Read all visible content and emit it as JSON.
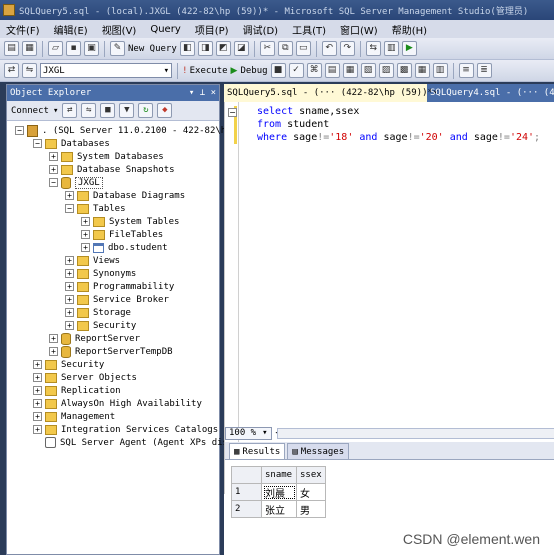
{
  "window": {
    "title": "SQLQuery5.sql - (local).JXGL (422-82\\hp (59))* - Microsoft SQL Server Management Studio(管理员)"
  },
  "menu": {
    "items": [
      "文件(F)",
      "编辑(E)",
      "视图(V)",
      "Query",
      "项目(P)",
      "调试(D)",
      "工具(T)",
      "窗口(W)",
      "帮助(H)"
    ]
  },
  "toolbar": {
    "new_query_label": "New Query",
    "database": "JXGL",
    "execute_label": "Execute",
    "debug_label": "Debug"
  },
  "object_explorer": {
    "title": "Object Explorer",
    "connect_label": "Connect",
    "server": ". (SQL Server 11.0.2100 - 422-82\\hp",
    "nodes": {
      "databases": "Databases",
      "system_databases": "System Databases",
      "database_snapshots": "Database Snapshots",
      "jxgl": "JXGL",
      "database_diagrams": "Database Diagrams",
      "tables": "Tables",
      "system_tables": "System Tables",
      "file_tables": "FileTables",
      "dbo_student": "dbo.student",
      "views": "Views",
      "synonyms": "Synonyms",
      "programmability": "Programmability",
      "service_broker": "Service Broker",
      "storage": "Storage",
      "security_db": "Security",
      "report_server": "ReportServer",
      "report_server_temp": "ReportServerTempDB",
      "security": "Security",
      "server_objects": "Server Objects",
      "replication": "Replication",
      "alwayson": "AlwaysOn High Availability",
      "management": "Management",
      "integration": "Integration Services Catalogs",
      "agent": "SQL Server Agent (Agent XPs dis"
    }
  },
  "tabs": {
    "active": "SQLQuery5.sql - (··· (422-82\\hp (59))*",
    "inactive": "SQLQuery4.sql - (··· (422-8"
  },
  "editor": {
    "line1": {
      "kw": "select",
      "rest": " sname,ssex"
    },
    "line2": {
      "kw": "from",
      "rest": " student"
    },
    "line3": {
      "kw1": "where",
      "col1": " sage",
      "op1": "!=",
      "val1": "'18'",
      "kw2": " and",
      "col2": " sage",
      "op2": "!=",
      "val2": "'20'",
      "kw3": "  and",
      "col3": " sage",
      "op3": "!=",
      "val3": "'24'",
      "end": ";"
    }
  },
  "zoom": "100 %",
  "results": {
    "tab_results": "Results",
    "tab_messages": "Messages",
    "columns": [
      "sname",
      "ssex"
    ],
    "rows": [
      {
        "num": "1",
        "sname": "刘晨",
        "ssex": "女"
      },
      {
        "num": "2",
        "sname": "张立",
        "ssex": "男"
      }
    ]
  },
  "watermark": "CSDN @element.wen"
}
